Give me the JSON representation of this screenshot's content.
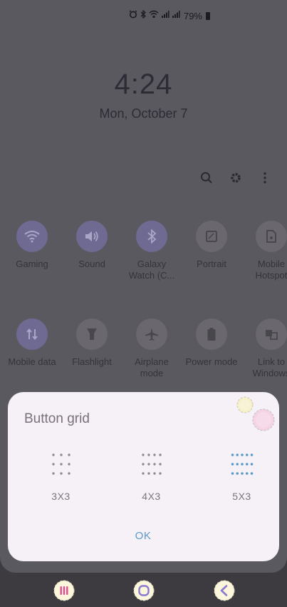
{
  "status_bar": {
    "battery_pct": "79%"
  },
  "lockscreen": {
    "time": "4:24",
    "date": "Mon, October 7"
  },
  "top_actions": [
    "search-icon",
    "settings-icon",
    "more-options-icon"
  ],
  "tiles_row1": [
    {
      "label": "Gaming",
      "icon": "wifi-icon",
      "on": true
    },
    {
      "label": "Sound",
      "icon": "sound-icon",
      "on": true
    },
    {
      "label": "Galaxy Watch (C...",
      "icon": "bluetooth-icon",
      "on": true
    },
    {
      "label": "Portrait",
      "icon": "rotate-icon",
      "on": false
    },
    {
      "label": "Mobile Hotspot",
      "icon": "hotspot-icon",
      "on": false
    }
  ],
  "tiles_row2": [
    {
      "label": "Mobile data",
      "icon": "mobile-data-icon",
      "on": true
    },
    {
      "label": "Flashlight",
      "icon": "flashlight-icon",
      "on": false
    },
    {
      "label": "Airplane mode",
      "icon": "airplane-icon",
      "on": false
    },
    {
      "label": "Power mode",
      "icon": "power-mode-icon",
      "on": false
    },
    {
      "label": "Link to Windows",
      "icon": "link-windows-icon",
      "on": false
    }
  ],
  "dialog": {
    "title": "Button grid",
    "options": [
      {
        "label": "3X3",
        "cols": 3,
        "selected": false
      },
      {
        "label": "4X3",
        "cols": 4,
        "selected": false
      },
      {
        "label": "5X3",
        "cols": 5,
        "selected": true
      }
    ],
    "ok_label": "OK"
  },
  "colors": {
    "accent": "#5c9ac7",
    "dialog_bg": "#f5f1f7",
    "nav_icon_pink": "#e24b8f",
    "nav_icon_purple": "#8a7ad0"
  }
}
